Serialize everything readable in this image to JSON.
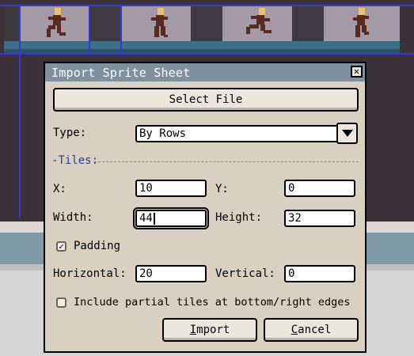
{
  "dialog": {
    "title": "Import Sprite Sheet",
    "select_file_label": "Select File",
    "type_label": "Type:",
    "type_value": "By Rows",
    "tiles_section_label": "Tiles:",
    "x_label": "X:",
    "x_value": "10",
    "y_label": "Y:",
    "y_value": "0",
    "width_label": "Width:",
    "width_value": "44",
    "height_label": "Height:",
    "height_value": "32",
    "padding_label": "Padding",
    "padding_checked": true,
    "horizontal_label": "Horizontal:",
    "horizontal_value": "20",
    "vertical_label": "Vertical:",
    "vertical_value": "0",
    "partial_tiles_label": "Include partial tiles at bottom/right edges",
    "partial_tiles_checked": false,
    "import_label": "Import",
    "cancel_label": "Cancel"
  },
  "icons": {
    "close": "close-icon",
    "dropdown": "chevron-down-icon",
    "check": "check-icon"
  },
  "colors": {
    "titlebar": "#7d929e",
    "dialog_bg": "#d9d0c2",
    "grid_lines": "#3535e0",
    "section_label": "#2c3d9c"
  }
}
